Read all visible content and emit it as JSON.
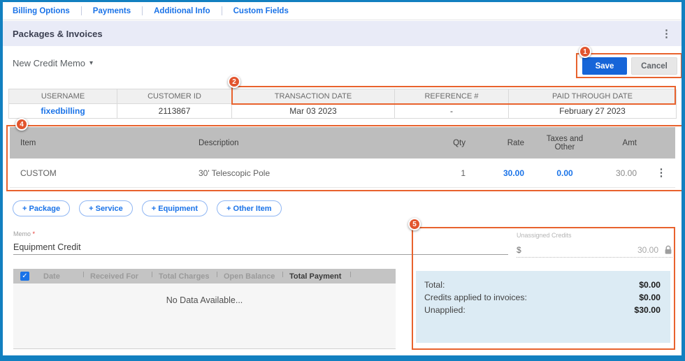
{
  "nav": {
    "tabs": [
      "Billing Options",
      "Payments",
      "Additional Info",
      "Custom Fields"
    ]
  },
  "section": {
    "title": "Packages & Invoices",
    "menu_icon": "kebab"
  },
  "toolbar": {
    "dropdown_label": "New Credit Memo",
    "save_label": "Save",
    "cancel_label": "Cancel"
  },
  "customer_table": {
    "headers": [
      "USERNAME",
      "CUSTOMER ID",
      "TRANSACTION DATE",
      "REFERENCE #",
      "PAID THROUGH DATE"
    ],
    "row": [
      "fixedbilling",
      "2113867",
      "Mar 03 2023",
      "-",
      "February 27 2023"
    ]
  },
  "items_table": {
    "headers": [
      "Item",
      "Description",
      "Qty",
      "Rate",
      "Taxes and Other",
      "Amt"
    ],
    "row": {
      "item": "CUSTOM",
      "description": "30' Telescopic Pole",
      "qty": "1",
      "rate": "30.00",
      "taxes_and_other": "0.00",
      "amt": "30.00"
    }
  },
  "add_buttons": [
    "+ Package",
    "+ Service",
    "+ Equipment",
    "+ Other Item"
  ],
  "memo": {
    "label": "Memo",
    "required_mark": "*",
    "value": "Equipment Credit"
  },
  "unassigned_credits": {
    "label": "Unassigned Credits",
    "currency": "$",
    "value": "30.00",
    "locked": true
  },
  "payments_table": {
    "headers": [
      "Date",
      "Received For",
      "Total Charges",
      "Open Balance",
      "Total Payment"
    ],
    "empty_text": "No Data Available..."
  },
  "summary": {
    "rows": [
      {
        "label": "Total:",
        "value": "$0.00"
      },
      {
        "label": "Credits applied to invoices:",
        "value": "$0.00"
      },
      {
        "label": "Unapplied:",
        "value": "$30.00"
      }
    ]
  },
  "annotations": {
    "step1": "1",
    "step2": "2",
    "step4": "4",
    "step5": "5"
  },
  "colors": {
    "accent_blue": "#1a73e8",
    "save_blue": "#1665d8",
    "annotation_orange": "#e8622d",
    "summary_bg": "#dcebf4",
    "frame_blue": "#1280c0",
    "header_bar_bg": "#e9ebf7",
    "grid_header_gray": "#bdbdbd"
  }
}
